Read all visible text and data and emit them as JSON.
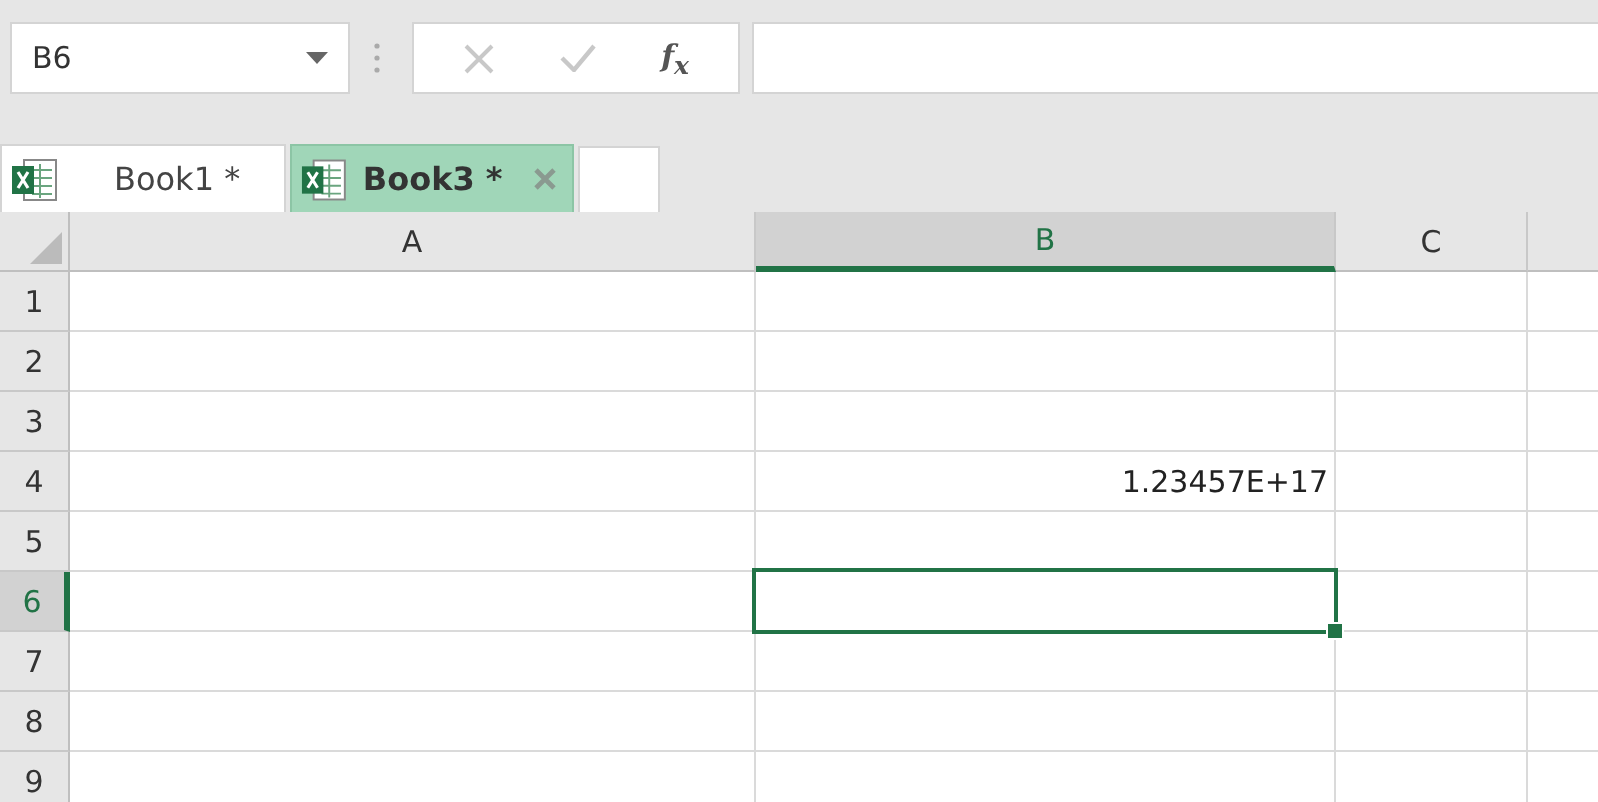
{
  "name_box": {
    "value": "B6"
  },
  "formula_bar": {
    "function_label": "f$_{x}$"
  },
  "tabs": [
    {
      "label": "Book1 *",
      "selected": false
    },
    {
      "label": "Book3 *",
      "selected": true
    }
  ],
  "sheet": {
    "columns": [
      {
        "label": "A",
        "selected": false
      },
      {
        "label": "B",
        "selected": true
      },
      {
        "label": "C",
        "selected": false
      }
    ],
    "rows": [
      {
        "label": "1",
        "selected": false
      },
      {
        "label": "2",
        "selected": false
      },
      {
        "label": "3",
        "selected": false
      },
      {
        "label": "4",
        "selected": false,
        "column_b": "1.23457E+17"
      },
      {
        "label": "5",
        "selected": false
      },
      {
        "label": "6",
        "selected": true
      },
      {
        "label": "7",
        "selected": false
      },
      {
        "label": "8",
        "selected": false
      },
      {
        "label": "9",
        "selected": false
      }
    ]
  }
}
